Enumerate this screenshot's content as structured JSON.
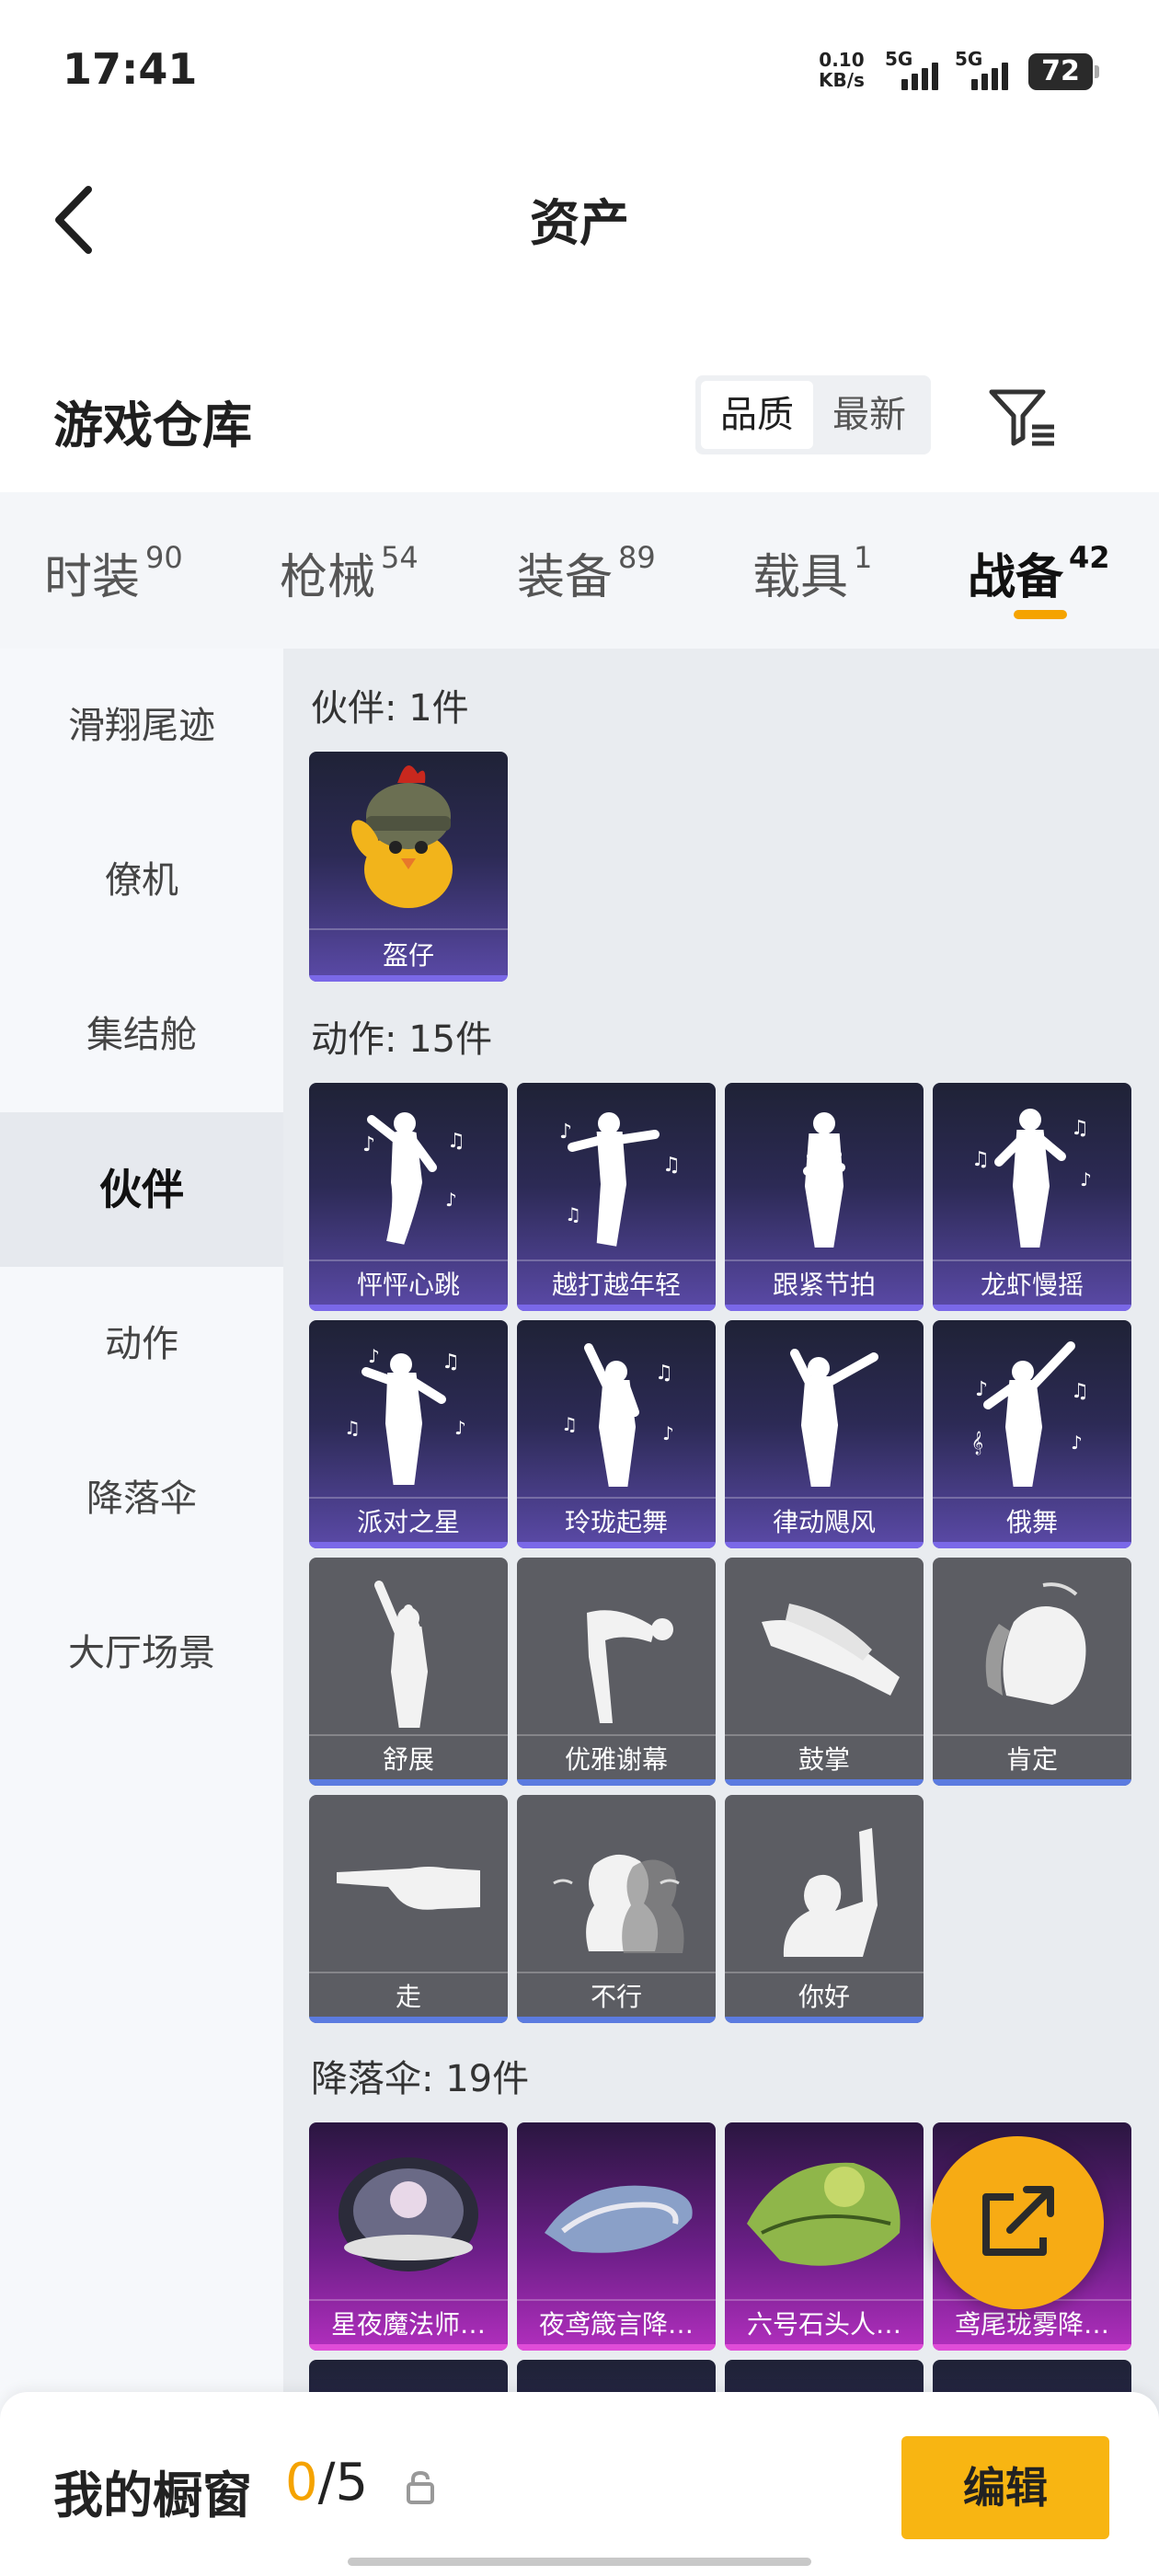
{
  "status": {
    "time": "17:41",
    "net_speed": "0.10",
    "net_unit": "KB/s",
    "sim1": "5G",
    "sim2": "5G",
    "battery": "72"
  },
  "header": {
    "title": "资产"
  },
  "warehouse": {
    "title": "游戏仓库",
    "sort_options": [
      "品质",
      "最新"
    ],
    "sort_selected": "品质"
  },
  "tabs": [
    {
      "label": "时装",
      "count": "90"
    },
    {
      "label": "枪械",
      "count": "54"
    },
    {
      "label": "装备",
      "count": "89"
    },
    {
      "label": "载具",
      "count": "1"
    },
    {
      "label": "战备",
      "count": "42"
    }
  ],
  "active_tab": "战备",
  "sidebar": [
    {
      "label": "滑翔尾迹"
    },
    {
      "label": "僚机"
    },
    {
      "label": "集结舱"
    },
    {
      "label": "伙伴"
    },
    {
      "label": "动作"
    },
    {
      "label": "降落伞"
    },
    {
      "label": "大厅场景"
    }
  ],
  "sidebar_active": "伙伴",
  "sections": {
    "partner": {
      "title": "伙伴: 1件",
      "items": [
        "盔仔"
      ]
    },
    "emote": {
      "title": "动作: 15件",
      "items": [
        "怦怦心跳",
        "越打越年轻",
        "跟紧节拍",
        "龙虾慢摇",
        "派对之星",
        "玲珑起舞",
        "律动飓风",
        "俄舞",
        "舒展",
        "优雅谢幕",
        "鼓掌",
        "肯定",
        "走",
        "不行",
        "你好"
      ]
    },
    "parachute": {
      "title": "降落伞: 19件",
      "items": [
        "星夜魔法师…",
        "夜鸢箴言降…",
        "六号石头人…",
        "鸢尾珑雾降…"
      ]
    }
  },
  "colors": {
    "accent": "#f5a300",
    "edit_button": "#f8b512",
    "epic_purple": "#5b4aa8",
    "legendary_pink": "#b22fbe",
    "common_gray": "#5c5d63"
  },
  "bottom": {
    "label": "我的橱窗",
    "current": "0",
    "total": "/5",
    "edit": "编辑"
  }
}
